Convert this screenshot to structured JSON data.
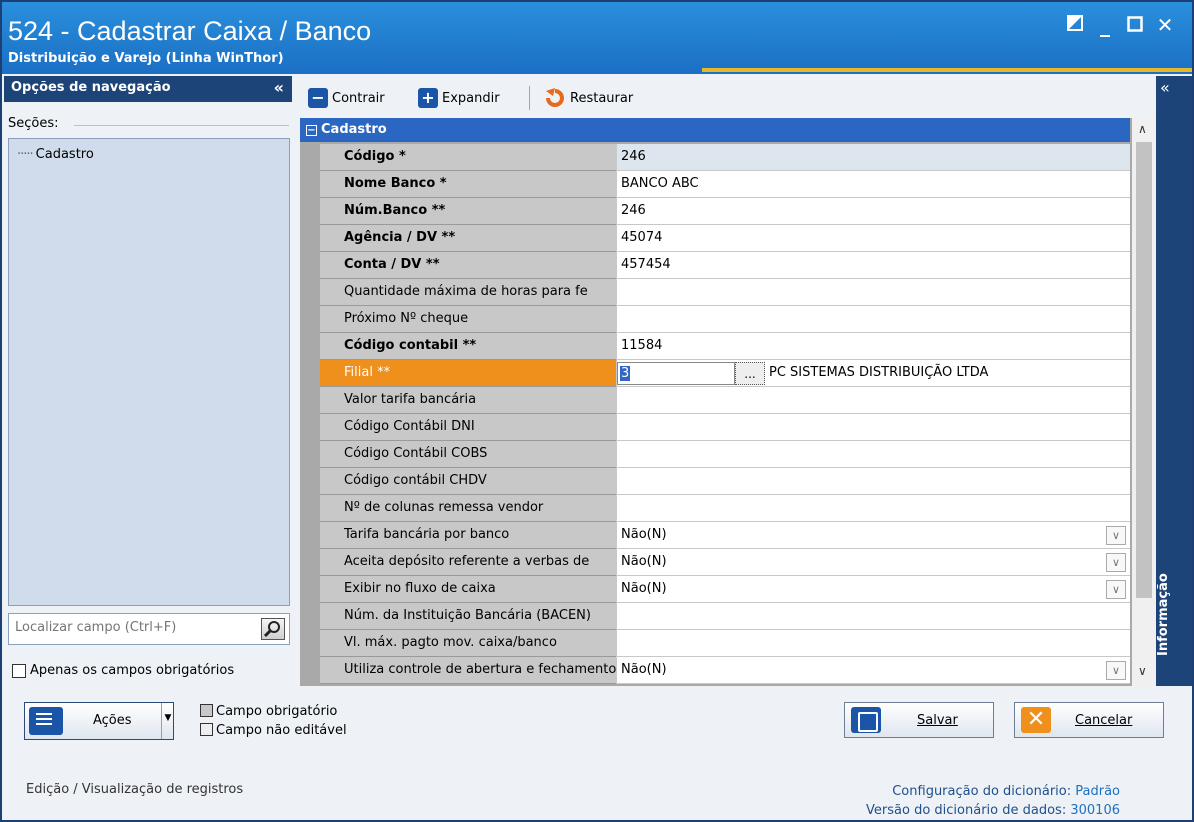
{
  "window": {
    "title": "524 - Cadastrar Caixa / Banco",
    "subtitle": "Distribuição e Varejo (Linha WinThor)"
  },
  "nav": {
    "header": "Opções de navegação",
    "sections_label": "Seções:",
    "tree_items": [
      "Cadastro"
    ],
    "search_placeholder": "Localizar campo (Ctrl+F)",
    "required_only_label": "Apenas os campos obrigatórios"
  },
  "toolbar": {
    "collapse_label": "Contrair",
    "expand_label": "Expandir",
    "restore_label": "Restaurar"
  },
  "info_panel": {
    "label": "Informação"
  },
  "grid": {
    "category": "Cadastro",
    "rows": [
      {
        "label": "Código *",
        "value": "246",
        "bold": true
      },
      {
        "label": "Nome Banco *",
        "value": "BANCO ABC",
        "bold": true
      },
      {
        "label": "Núm.Banco  **",
        "value": "246",
        "bold": true
      },
      {
        "label": "Agência / DV  **",
        "value": "45074",
        "bold": true
      },
      {
        "label": "Conta / DV  **",
        "value": "457454",
        "bold": true
      },
      {
        "label": "Quantidade máxima de horas para fe",
        "value": "",
        "bold": false
      },
      {
        "label": "Próximo Nº cheque",
        "value": "",
        "bold": false
      },
      {
        "label": "Código contabil **",
        "value": "11584",
        "bold": true
      },
      {
        "label": "Filial **",
        "value": "3",
        "extra": "PC SISTEMAS DISTRIBUIÇÃO LTDA",
        "ellipsis": "...",
        "bold": false
      },
      {
        "label": "Valor tarifa bancária",
        "value": "",
        "bold": false
      },
      {
        "label": "Código Contábil DNI",
        "value": "",
        "bold": false
      },
      {
        "label": "Código Contábil COBS",
        "value": "",
        "bold": false
      },
      {
        "label": "Código contábil CHDV",
        "value": "",
        "bold": false
      },
      {
        "label": "Nº de colunas remessa vendor",
        "value": "",
        "bold": false
      },
      {
        "label": "Tarifa bancária por banco",
        "value": "Não(N)",
        "bold": false
      },
      {
        "label": "Aceita depósito referente a verbas de",
        "value": "Não(N)",
        "bold": false
      },
      {
        "label": "Exibir no fluxo de caixa",
        "value": "Não(N)",
        "bold": false
      },
      {
        "label": "Núm. da Instituição Bancária (BACEN)",
        "value": "",
        "bold": false
      },
      {
        "label": "Vl. máx. pagto mov. caixa/banco",
        "value": "",
        "bold": false
      },
      {
        "label": "Utiliza controle de abertura e fechamento",
        "value": "Não(N)",
        "bold": false
      }
    ]
  },
  "bottom": {
    "actions_label": "Ações",
    "legend_required": "Campo obrigatório",
    "legend_readonly": "Campo não editável",
    "save_label": "Salvar",
    "cancel_label": "Cancelar",
    "status_left": "Edição / Visualização de registros",
    "dict_config_label": "Configuração do dicionário:",
    "dict_config_value": "Padrão",
    "dict_version_label": "Versão do dicionário de dados:",
    "dict_version_value": "300106"
  },
  "colors": {
    "title_bar": "#1b6fc4",
    "nav_header": "#1c4478",
    "category_header": "#2b66c3",
    "active_row": "#ef8f1c"
  }
}
